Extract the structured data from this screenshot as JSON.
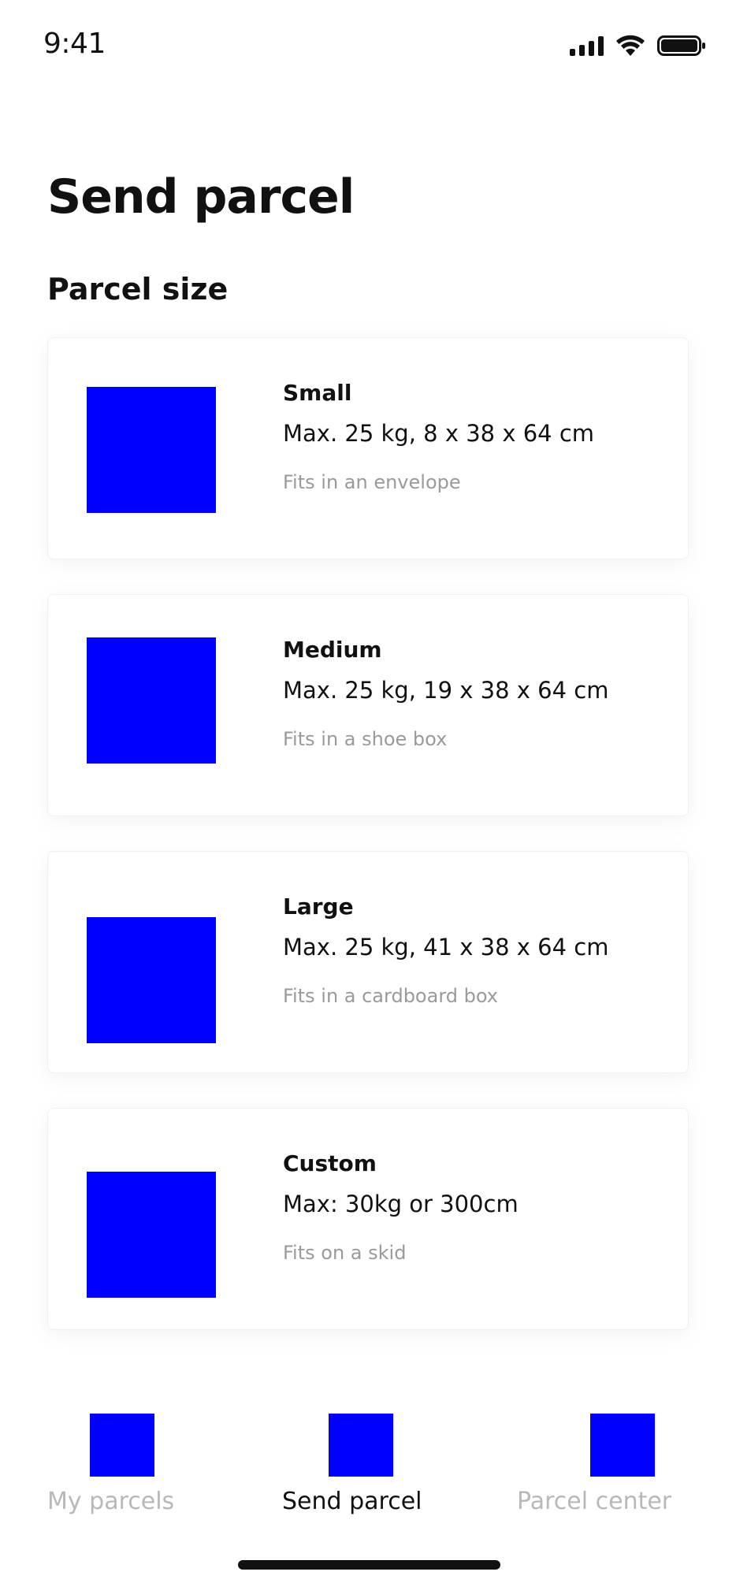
{
  "status_bar": {
    "time": "9:41"
  },
  "page": {
    "title": "Send parcel",
    "section_title": "Parcel size"
  },
  "parcel_sizes": [
    {
      "name": "Small",
      "spec": "Max. 25 kg, 8 x 38 x 64 cm",
      "note": "Fits in an envelope"
    },
    {
      "name": "Medium",
      "spec": "Max. 25 kg, 19 x 38 x 64 cm",
      "note": "Fits in a shoe box"
    },
    {
      "name": "Large",
      "spec": "Max. 25 kg, 41 x 38 x 64 cm",
      "note": "Fits in a cardboard box"
    },
    {
      "name": "Custom",
      "spec": "Max: 30kg or 300cm",
      "note": "Fits on a skid"
    }
  ],
  "bottom_nav": {
    "items": [
      {
        "label": "My parcels",
        "active": false
      },
      {
        "label": "Send parcel",
        "active": true
      },
      {
        "label": "Parcel center",
        "active": false
      }
    ]
  },
  "colors": {
    "text_primary": "#111111",
    "text_secondary": "#9a9a9a",
    "nav_inactive": "#b8b8b8",
    "placeholder_image": "#0000ff"
  }
}
